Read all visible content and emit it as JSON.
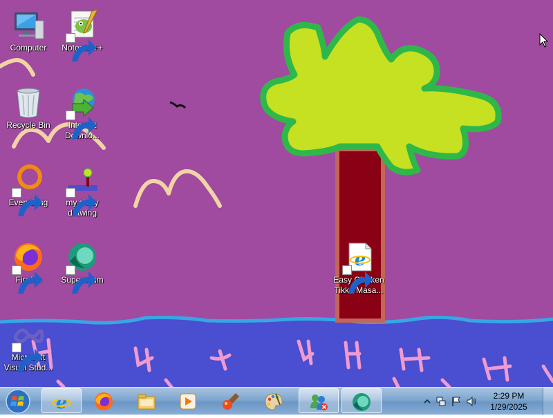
{
  "desktop_icons": [
    {
      "id": "computer",
      "label": "Computer"
    },
    {
      "id": "notepadpp",
      "label": "Notepad++"
    },
    {
      "id": "recycle-bin",
      "label": "Recycle Bin"
    },
    {
      "id": "internet-download",
      "label": "Internet Downlo..."
    },
    {
      "id": "everything",
      "label": "Everything"
    },
    {
      "id": "drawing",
      "label": "my shitty drawing"
    },
    {
      "id": "firefox",
      "label": "Firefox"
    },
    {
      "id": "supermium",
      "label": "Supermium"
    },
    {
      "id": "visual-studio",
      "label": "Microsoft Visual Stud..."
    },
    {
      "id": "easy-chicken",
      "label": "Easy Chicken Tikka Masa..."
    }
  ],
  "taskbar": {
    "pinned": [
      {
        "name": "internet-explorer-icon"
      },
      {
        "name": "firefox-icon"
      },
      {
        "name": "file-explorer-icon"
      },
      {
        "name": "media-player-icon"
      },
      {
        "name": "paint-icon"
      },
      {
        "name": "paint-palette-icon"
      },
      {
        "name": "users-network-icon"
      },
      {
        "name": "supermium-icon"
      }
    ],
    "clock": {
      "time": "2:29 PM",
      "date": "1/29/2025"
    }
  },
  "colors": {
    "sky": "#a04aa0",
    "water": "#4a4ed0",
    "tree_leaves": "#c6e022",
    "tree_outline": "#2fb84a",
    "trunk": "#8a0015",
    "trunk_outline": "#c4655a",
    "taskbar": "#7ea6cf"
  }
}
